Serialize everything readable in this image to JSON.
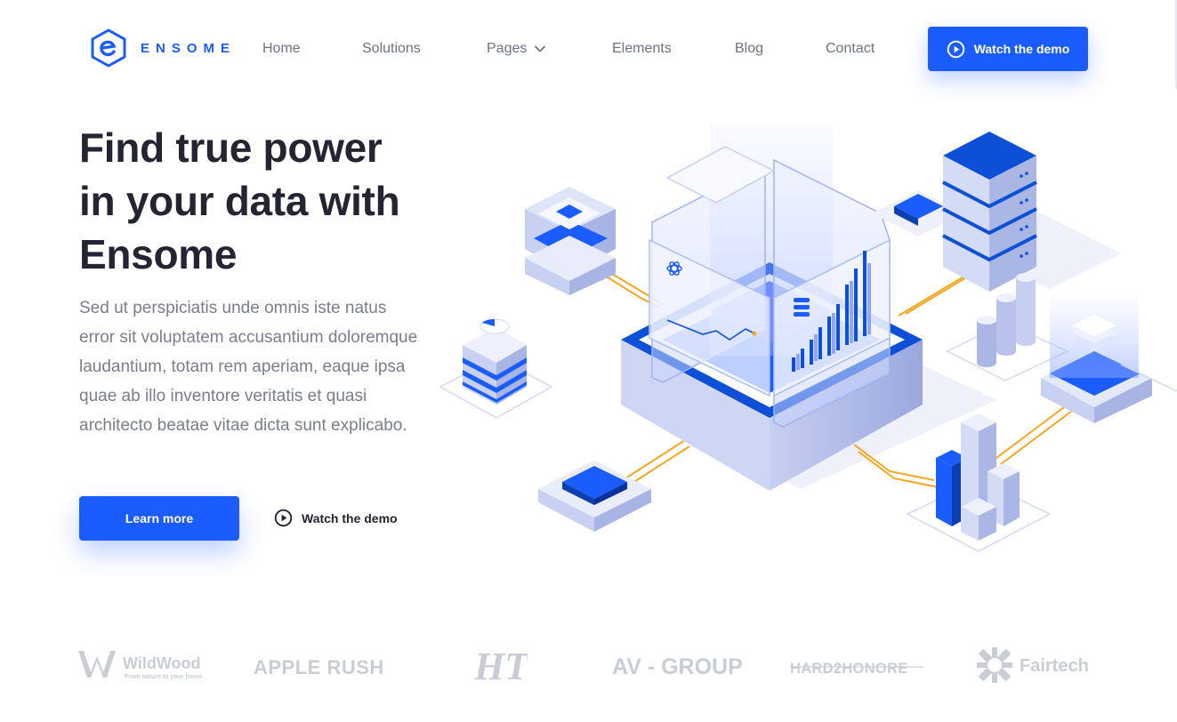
{
  "nav": {
    "brand_name": "ENSOME",
    "items": [
      "Home",
      "Solutions",
      "Pages",
      "Elements",
      "Blog",
      "Contact"
    ],
    "cta_label": "Watch the demo"
  },
  "hero": {
    "title_lines": [
      "Find true power",
      "in your data with",
      "Ensome"
    ],
    "description": "Sed ut perspiciatis unde omnis iste natus error sit voluptatem accusantium doloremque laudantium, totam rem aperiam, eaque ipsa quae ab illo inventore veritatis et quasi architecto beatae vitae dicta sunt explicabo.",
    "primary_button": "Learn more",
    "secondary_button": "Watch the demo"
  },
  "brands": {
    "items": [
      {
        "name": "WildWood",
        "tagline": "From nature to your home"
      },
      {
        "name": "APPLE RUSH"
      },
      {
        "name": "HT"
      },
      {
        "name": "AV - GROUP"
      },
      {
        "name": "HARD2HONORE"
      },
      {
        "name": "Fairtech"
      }
    ]
  },
  "colors": {
    "accent": "#1b5cff",
    "heading": "#232533",
    "body_text": "#7a7e8c",
    "nav_text": "#6d7282",
    "brand_logos": "#c2c6d0",
    "illustration_orange": "#f5a623"
  },
  "icons": [
    "logo-e-icon",
    "chevron-down-icon",
    "play-circle-icon"
  ]
}
